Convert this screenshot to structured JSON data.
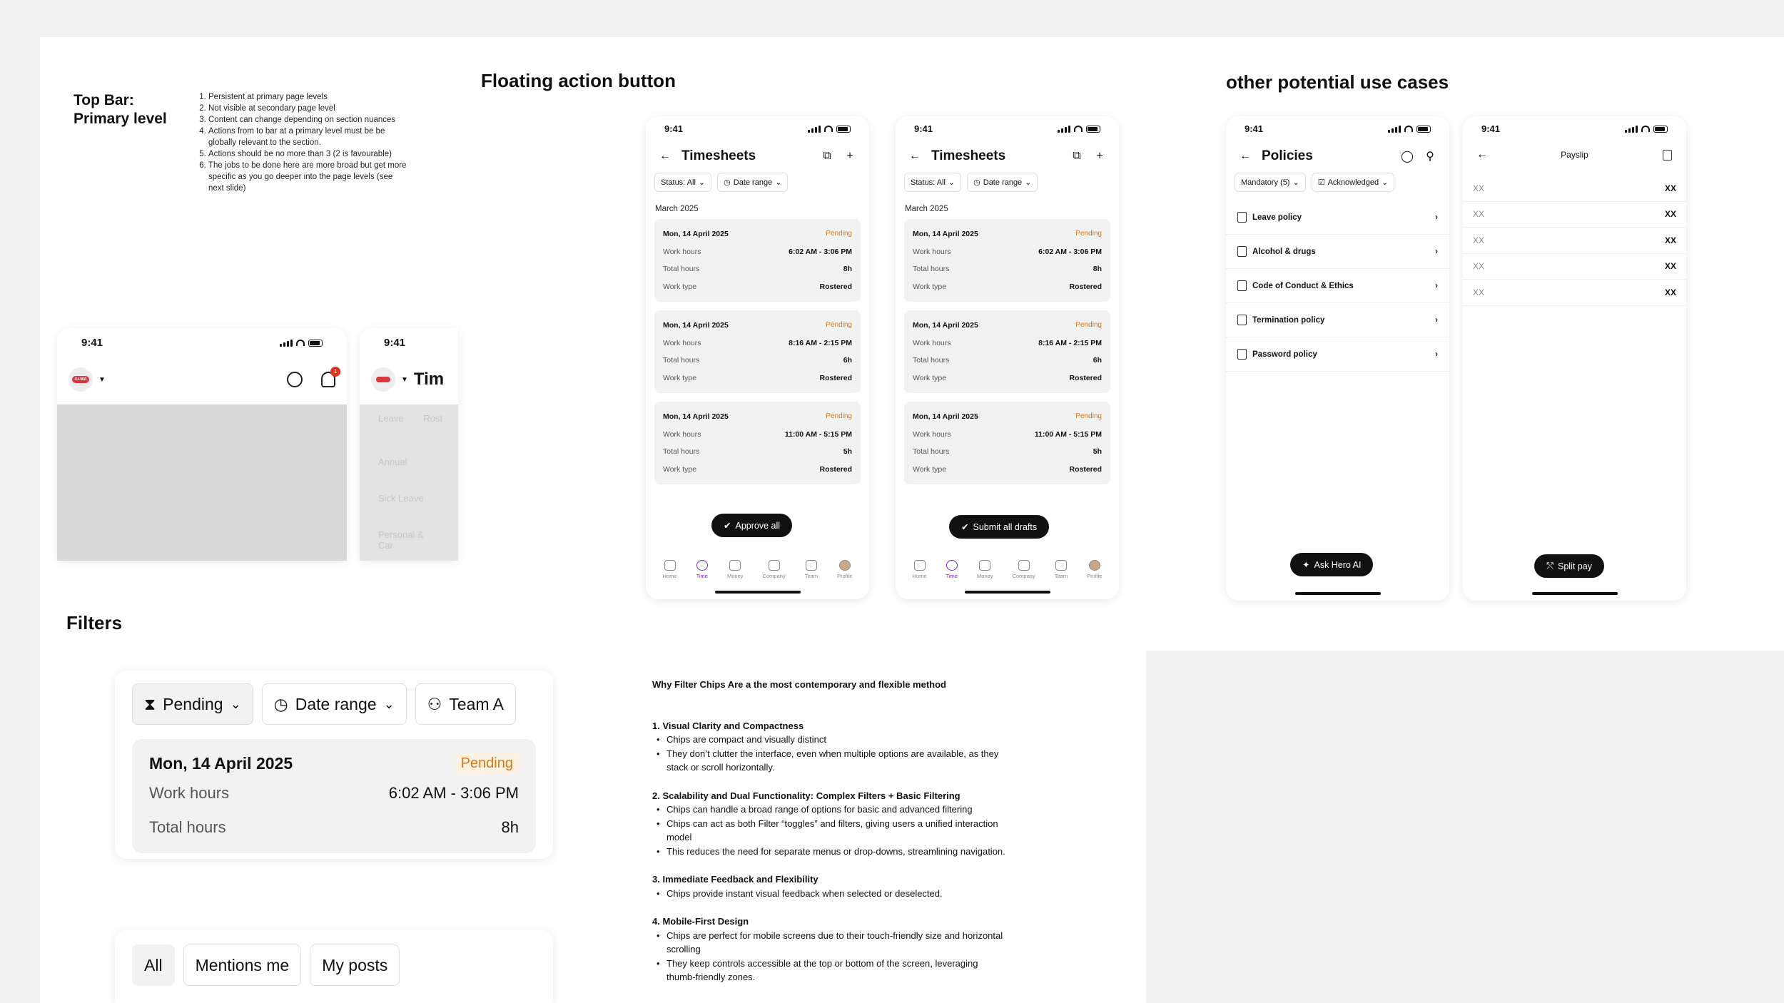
{
  "top_bar_section": {
    "title_line1": "Top Bar:",
    "title_line2": "Primary level",
    "notes": [
      "Persistent at primary page levels",
      "Not visible at secondary page level",
      "Content can change depending on section nuances",
      "Actions from to bar at a primary level must be be globally relevant to the section.",
      "Actions should be no more than 3 (2 is favourable)",
      "The jobs to be done here are more broad but get more specific as you go deeper into the page levels (see next slide)"
    ],
    "phone1": {
      "time": "9:41",
      "logo": "ALMA",
      "badge": "1"
    },
    "phone2": {
      "time": "9:41",
      "title_partial": "Tim",
      "faded": [
        "Leave",
        "Rost",
        "Annual",
        "Sick Leave",
        "Personal & Car"
      ]
    }
  },
  "fab_section": {
    "title": "Floating action button",
    "phones": [
      {
        "time": "9:41",
        "title": "Timesheets",
        "chip_status": "Status: All",
        "chip_date": "Date range",
        "month": "March 2025",
        "fab": "Approve all",
        "cards": [
          {
            "date": "Mon, 14 April 2025",
            "status": "Pending",
            "work_label": "Work hours",
            "work": "6:02 AM - 3:06 PM",
            "total_label": "Total hours",
            "total": "8h",
            "type_label": "Work type",
            "type": "Rostered"
          },
          {
            "date": "Mon, 14 April 2025",
            "status": "Pending",
            "work_label": "Work hours",
            "work": "8:16 AM - 2:15 PM",
            "total_label": "Total hours",
            "total": "6h",
            "type_label": "Work type",
            "type": "Rostered"
          },
          {
            "date": "Mon, 14 April 2025",
            "status": "Pending",
            "work_label": "Work hours",
            "work": "11:00 AM - 5:15 PM",
            "total_label": "Total hours",
            "total": "5h",
            "type_label": "Work type",
            "type": "Rostered"
          }
        ]
      },
      {
        "time": "9:41",
        "title": "Timesheets",
        "chip_status": "Status: All",
        "chip_date": "Date range",
        "month": "March 2025",
        "fab": "Submit all drafts",
        "cards": [
          {
            "date": "Mon, 14 April 2025",
            "status": "Pending",
            "work_label": "Work hours",
            "work": "6:02 AM - 3:06 PM",
            "total_label": "Total hours",
            "total": "8h",
            "type_label": "Work type",
            "type": "Rostered"
          },
          {
            "date": "Mon, 14 April 2025",
            "status": "Pending",
            "work_label": "Work hours",
            "work": "8:16 AM - 2:15 PM",
            "total_label": "Total hours",
            "total": "6h",
            "type_label": "Work type",
            "type": "Rostered"
          },
          {
            "date": "Mon, 14 April 2025",
            "status": "Pending",
            "work_label": "Work hours",
            "work": "11:00 AM - 5:15 PM",
            "total_label": "Total hours",
            "total": "5h",
            "type_label": "Work type",
            "type": "Rostered"
          }
        ]
      }
    ],
    "nav": [
      "Home",
      "Time",
      "Money",
      "Company",
      "Team",
      "Profile"
    ]
  },
  "use_cases_section": {
    "title": "other potential use cases",
    "policies_phone": {
      "time": "9:41",
      "title": "Policies",
      "chip_mandatory": "Mandatory (5)",
      "chip_ack": "Acknowledged",
      "items": [
        "Leave policy",
        "Alcohol & drugs",
        "Code of Conduct & Ethics",
        "Termination policy",
        "Password policy"
      ],
      "fab": "Ask Hero AI"
    },
    "payslip_phone": {
      "time": "9:41",
      "title": "Payslip",
      "rows": [
        [
          "XX",
          "XX"
        ],
        [
          "XX",
          "XX"
        ],
        [
          "XX",
          "XX"
        ],
        [
          "XX",
          "XX"
        ],
        [
          "XX",
          "XX"
        ]
      ],
      "fab": "Split pay"
    }
  },
  "filters_section": {
    "title": "Filters",
    "chips": [
      "Pending",
      "Date range",
      "Team A"
    ],
    "card": {
      "date": "Mon, 14 April 2025",
      "status": "Pending",
      "work_label": "Work hours",
      "work": "6:02 AM - 3:06 PM",
      "total_label": "Total hours",
      "total": "8h"
    },
    "tabs": [
      "All",
      "Mentions me",
      "My posts"
    ]
  },
  "essay": {
    "heading": "Why Filter Chips Are a the most contemporary and flexible method",
    "sections": [
      {
        "title": "1. Visual Clarity and Compactness",
        "bullets": [
          "Chips are compact and visually distinct",
          "They don’t clutter the interface, even when multiple options are available, as they stack or scroll horizontally."
        ]
      },
      {
        "title": "2. Scalability and Dual Functionality: Complex Filters + Basic Filtering",
        "bullets": [
          "Chips can handle a broad range of options for basic and advanced filtering",
          "Chips can act as both Filter “toggles” and filters, giving users a unified interaction model",
          "This reduces the need for separate menus or drop-downs, streamlining navigation."
        ]
      },
      {
        "title": "3. Immediate Feedback and Flexibility",
        "bullets": [
          "Chips provide instant visual feedback when selected or deselected."
        ]
      },
      {
        "title": "4. Mobile-First Design",
        "bullets": [
          "Chips are perfect for mobile screens due to their touch-friendly size and horizontal scrolling",
          "They keep controls accessible at the top or bottom of the screen, leveraging thumb-friendly zones."
        ]
      }
    ]
  },
  "colors": {
    "accent": "#7b2cbf",
    "pending": "#d57a12",
    "badge": "#e0321c",
    "logo": "#d9383f"
  }
}
